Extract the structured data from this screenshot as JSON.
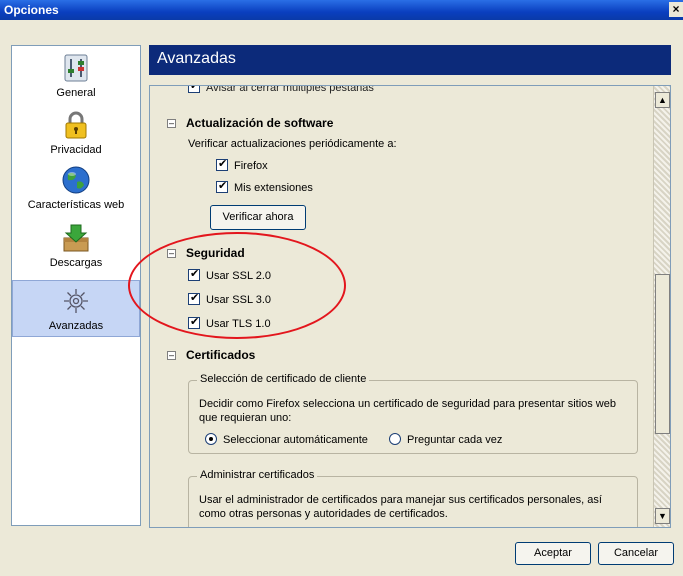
{
  "window": {
    "title": "Opciones",
    "close": "×"
  },
  "sidebar": {
    "items": [
      {
        "label": "General",
        "icon": "switches-icon"
      },
      {
        "label": "Privacidad",
        "icon": "padlock-icon"
      },
      {
        "label": "Características web",
        "icon": "globe-icon"
      },
      {
        "label": "Descargas",
        "icon": "download-box-icon"
      },
      {
        "label": "Avanzadas",
        "icon": "gear-icon",
        "selected": true
      }
    ]
  },
  "header": {
    "title": "Avanzadas"
  },
  "content": {
    "top_item": "Avisar al cerrar múltiples pestañas",
    "update": {
      "title": "Actualización de software",
      "intro": "Verificar actualizaciones periódicamente a:",
      "firefox": "Firefox",
      "extensions": "Mis extensiones",
      "check_now": "Verificar ahora"
    },
    "security": {
      "title": "Seguridad",
      "ssl2": "Usar SSL 2.0",
      "ssl3": "Usar SSL 3.0",
      "tls1": "Usar TLS 1.0"
    },
    "certificates": {
      "title": "Certificados",
      "client_group": "Selección de certificado de cliente",
      "client_desc": "Decidir como Firefox selecciona un certificado de seguridad para presentar sitios web que requieran uno:",
      "auto": "Seleccionar automáticamente",
      "ask": "Preguntar cada vez",
      "manage_group": "Administrar certificados",
      "manage_desc": "Usar el administrador de certificados para manejar sus certificados personales, así como otras personas y autoridades de certificados."
    }
  },
  "footer": {
    "accept": "Aceptar",
    "cancel": "Cancelar"
  },
  "colors": {
    "header_bg": "#0c2a7a",
    "titlebar": "#0a3fbf",
    "annotation_oval": "#e3161d"
  }
}
